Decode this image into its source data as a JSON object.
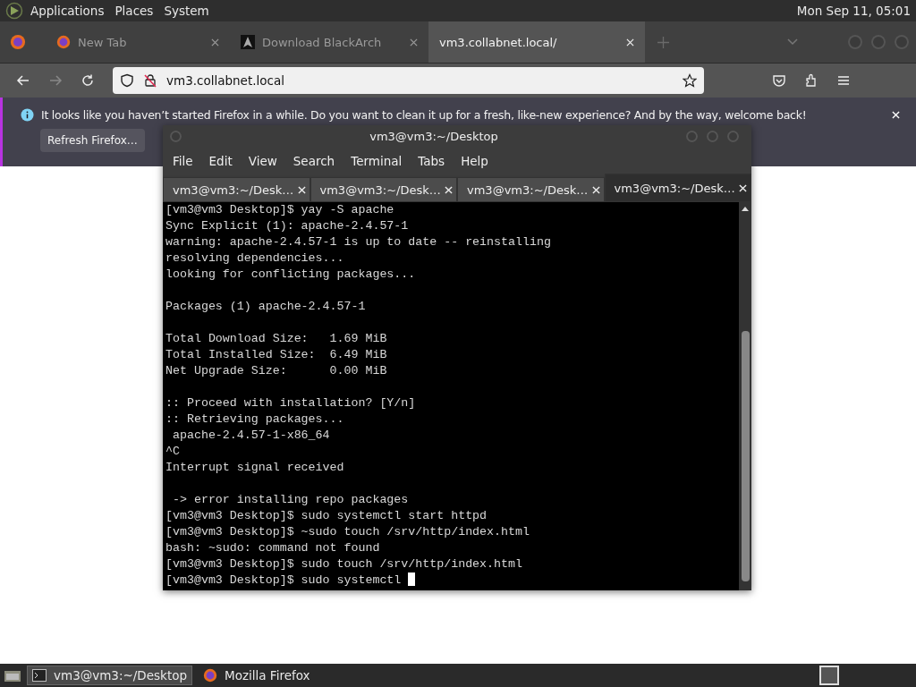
{
  "top_panel": {
    "menus": [
      "Applications",
      "Places",
      "System"
    ],
    "clock": "Mon Sep 11, 05:01"
  },
  "browser": {
    "tabs": [
      {
        "label": "New Tab",
        "selected": false
      },
      {
        "label": "Download BlackArch",
        "selected": false
      },
      {
        "label": "vm3.collabnet.local/",
        "selected": true
      }
    ],
    "url": "vm3.collabnet.local",
    "notification": {
      "message": "It looks like you haven’t started Firefox in a while. Do you want to clean it up for a fresh, like-new experience? And by the way, welcome back!",
      "button": "Refresh Firefox…"
    }
  },
  "terminal": {
    "title": "vm3@vm3:~/Desktop",
    "menus": [
      "File",
      "Edit",
      "View",
      "Search",
      "Terminal",
      "Tabs",
      "Help"
    ],
    "tabs": [
      {
        "label": "vm3@vm3:~/Desk…",
        "selected": false
      },
      {
        "label": "vm3@vm3:~/Desk…",
        "selected": false
      },
      {
        "label": "vm3@vm3:~/Desk…",
        "selected": false
      },
      {
        "label": "vm3@vm3:~/Desk…",
        "selected": true
      }
    ],
    "blocks": [
      {
        "lines": [
          "[vm3@vm3 Desktop]$ yay -S apache",
          "Sync Explicit (1): apache-2.4.57-1",
          "warning: apache-2.4.57-1 is up to date -- reinstalling",
          "resolving dependencies...",
          "looking for conflicting packages..."
        ]
      },
      {
        "lines": [
          "Packages (1) apache-2.4.57-1"
        ]
      },
      {
        "lines": [
          "Total Download Size:   1.69 MiB",
          "Total Installed Size:  6.49 MiB",
          "Net Upgrade Size:      0.00 MiB"
        ]
      },
      {
        "lines": [
          ":: Proceed with installation? [Y/n]",
          ":: Retrieving packages...",
          " apache-2.4.57-1-x86_64",
          "^C",
          "Interrupt signal received"
        ]
      },
      {
        "lines": [
          " -> error installing repo packages",
          "[vm3@vm3 Desktop]$ sudo systemctl start httpd",
          "[vm3@vm3 Desktop]$ ~sudo touch /srv/http/index.html",
          "bash: ~sudo: command not found",
          "[vm3@vm3 Desktop]$ sudo touch /srv/http/index.html",
          "[vm3@vm3 Desktop]$ sudo systemctl "
        ]
      }
    ]
  },
  "taskbar": {
    "items": [
      {
        "label": "vm3@vm3:~/Desktop",
        "selected": true
      },
      {
        "label": "Mozilla Firefox",
        "selected": false
      }
    ]
  }
}
